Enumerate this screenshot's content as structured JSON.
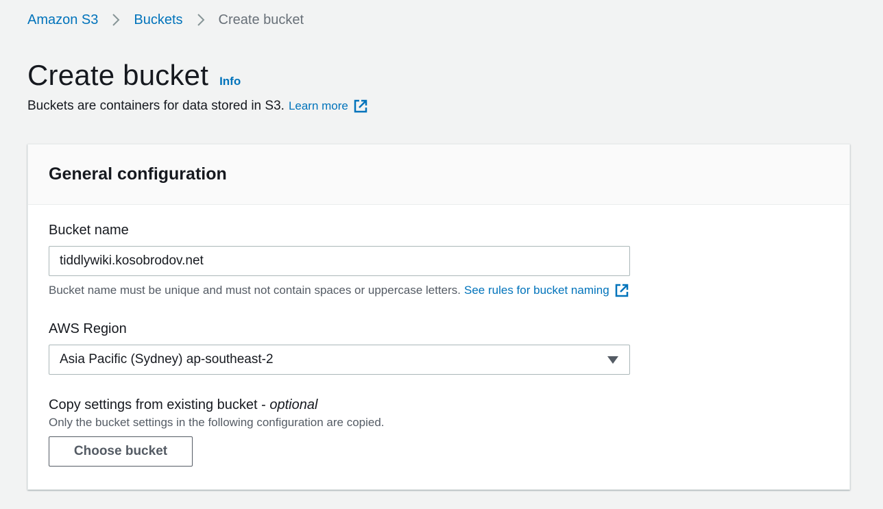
{
  "breadcrumb": {
    "items": [
      {
        "label": "Amazon S3"
      },
      {
        "label": "Buckets"
      },
      {
        "label": "Create bucket"
      }
    ]
  },
  "header": {
    "title": "Create bucket",
    "info_label": "Info",
    "description": "Buckets are containers for data stored in S3.",
    "learn_more_label": "Learn more"
  },
  "panel": {
    "title": "General configuration",
    "bucket_name": {
      "label": "Bucket name",
      "value": "tiddlywiki.kosobrodov.net",
      "hint": "Bucket name must be unique and must not contain spaces or uppercase letters.",
      "rules_link": "See rules for bucket naming"
    },
    "region": {
      "label": "AWS Region",
      "selected": "Asia Pacific (Sydney) ap-southeast-2"
    },
    "copy_settings": {
      "label": "Copy settings from existing bucket - ",
      "label_optional": "optional",
      "description": "Only the bucket settings in the following configuration are copied.",
      "button_label": "Choose bucket"
    }
  },
  "icons": {
    "breadcrumb_separator": "chevron-right-icon",
    "external_link": "external-link-icon",
    "dropdown": "caret-down-icon"
  },
  "colors": {
    "link": "#0073bb",
    "background": "#f2f3f3",
    "text": "#16191f",
    "secondary_text": "#545b64"
  }
}
